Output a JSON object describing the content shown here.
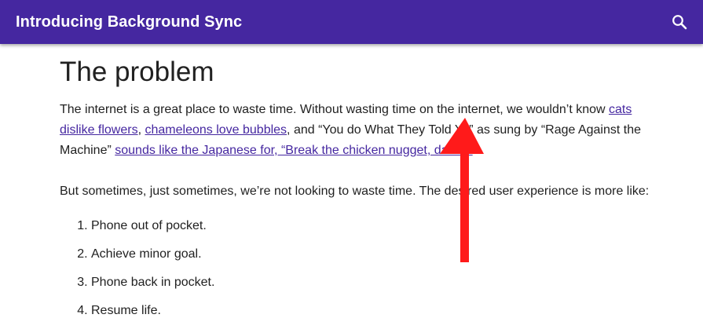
{
  "header": {
    "title": "Introducing Background Sync",
    "search_icon": "search-icon",
    "bg_color": "#4527a0"
  },
  "article": {
    "heading": "The problem",
    "p1": {
      "t1": "The internet is a great place to waste time. Without wasting time on the internet, we wouldn’t know ",
      "link1": "cats dislike flowers",
      "t2": ", ",
      "link2": "chameleons love bubbles",
      "t3": ", and “You do What They Told Ya” as sung by “Rage Against the Machine” ",
      "link3": "sounds like the Japanese for, “Break the chicken nugget, daddy”"
    },
    "p2": "But sometimes, just sometimes, we’re not looking to waste time. The desired user experience is more like:",
    "list": [
      "Phone out of pocket.",
      "Achieve minor goal.",
      "Phone back in pocket.",
      "Resume life."
    ]
  },
  "overlay": {
    "arrow_color": "#ff1a1a",
    "arrow_icon": "arrow-up-icon"
  }
}
